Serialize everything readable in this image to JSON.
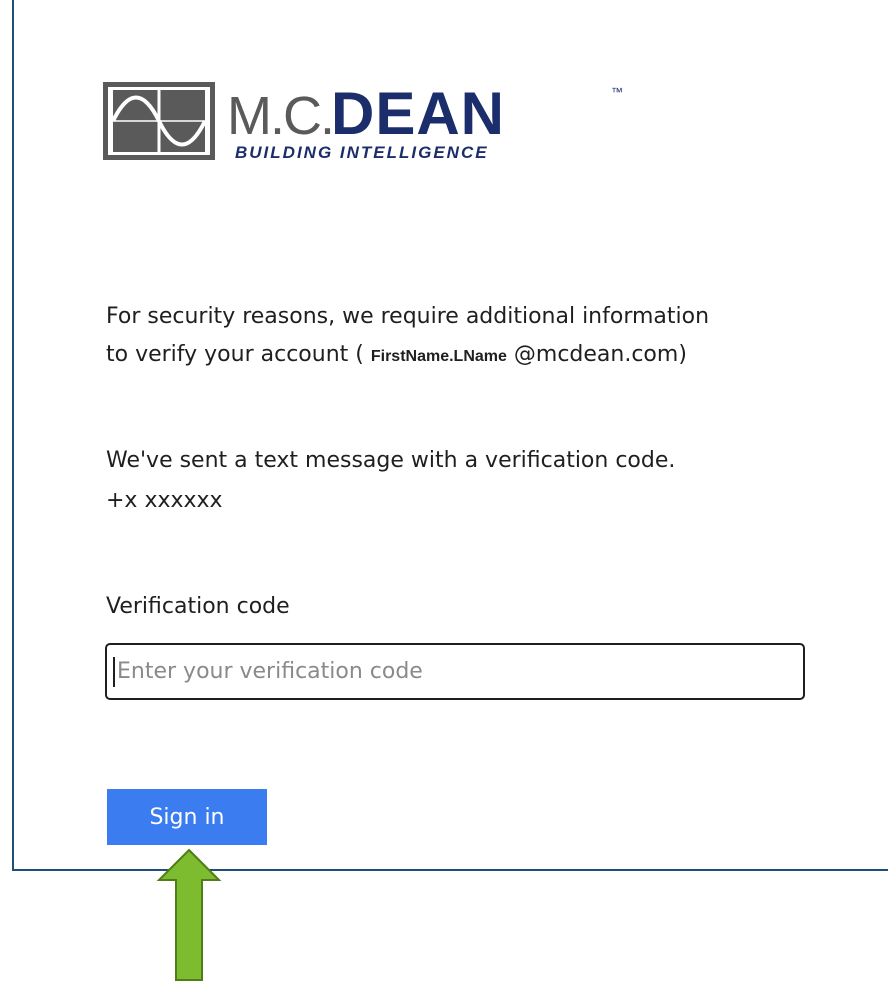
{
  "logo": {
    "brand_mc": "M.C.",
    "brand_dean": "DEAN",
    "trademark": "™",
    "tagline": "BUILDING INTELLIGENCE"
  },
  "message": {
    "line1": "For security reasons, we require additional information",
    "line2_prefix": "to verify your account ( ",
    "account_name": "FirstName.LName",
    "line2_suffix": " @mcdean.com)",
    "sent_text": "We've sent a text message with a verification code.",
    "phone": "+x xxxxxx"
  },
  "form": {
    "label": "Verification code",
    "placeholder": "Enter your verification code",
    "value": ""
  },
  "actions": {
    "sign_in_label": "Sign in"
  },
  "colors": {
    "border": "#1f4e79",
    "button": "#3b7cf0",
    "arrow_fill": "#7dbb2f",
    "arrow_stroke": "#4f7d17",
    "logo_gray": "#5a5a5a",
    "logo_navy": "#1b2d6b"
  },
  "icons": {
    "logo_mark": "sine-wave-logo-icon",
    "annotation": "up-arrow-annotation-icon"
  }
}
